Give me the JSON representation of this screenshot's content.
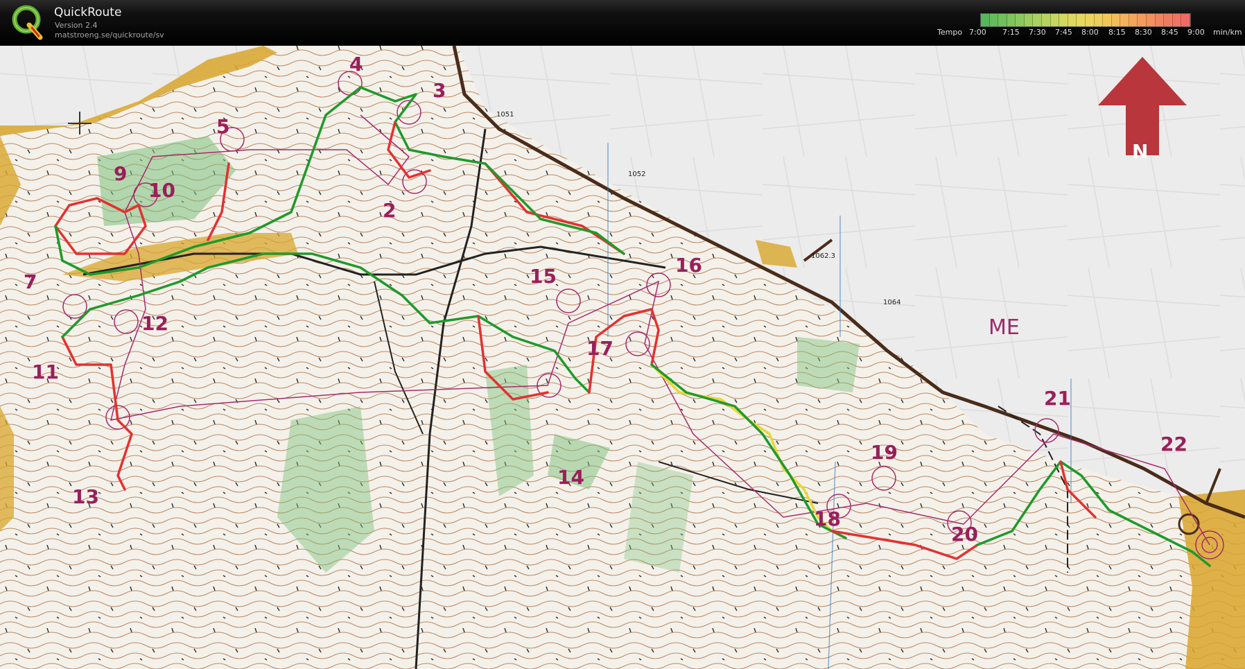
{
  "app": {
    "name": "QuickRoute",
    "version": "Version 2.4",
    "url": "matstroeng.se/quickroute/sv"
  },
  "legend": {
    "label": "Tempo",
    "unit": "min/km",
    "ticks": [
      "7:00",
      "7:15",
      "7:30",
      "7:45",
      "8:00",
      "8:15",
      "8:30",
      "8:45",
      "9:00"
    ],
    "gradient_colors": [
      "#56b85a",
      "#7cc35c",
      "#a7d060",
      "#cfd85f",
      "#ecd85c",
      "#f2c45a",
      "#f4a45c",
      "#f2835e",
      "#f06a66"
    ]
  },
  "map": {
    "north_label": "N",
    "area_label": "ME",
    "controls": [
      "2",
      "3",
      "4",
      "5",
      "7",
      "9",
      "10",
      "11",
      "12",
      "13",
      "14",
      "15",
      "16",
      "17",
      "18",
      "19",
      "20",
      "21",
      "22"
    ],
    "elevation_labels": [
      "1051",
      "1052",
      "1062.3",
      "1064"
    ],
    "colors": {
      "paper": "#eeeeee",
      "open_land": "#d9a62c",
      "green": "#7cc07a",
      "contour": "#a05a2a",
      "course": "#a8286a",
      "route_slow": "#e53030",
      "route_fast": "#1e9a2a",
      "route_mid": "#e8d63a",
      "north_arrow": "#b3262d"
    }
  }
}
